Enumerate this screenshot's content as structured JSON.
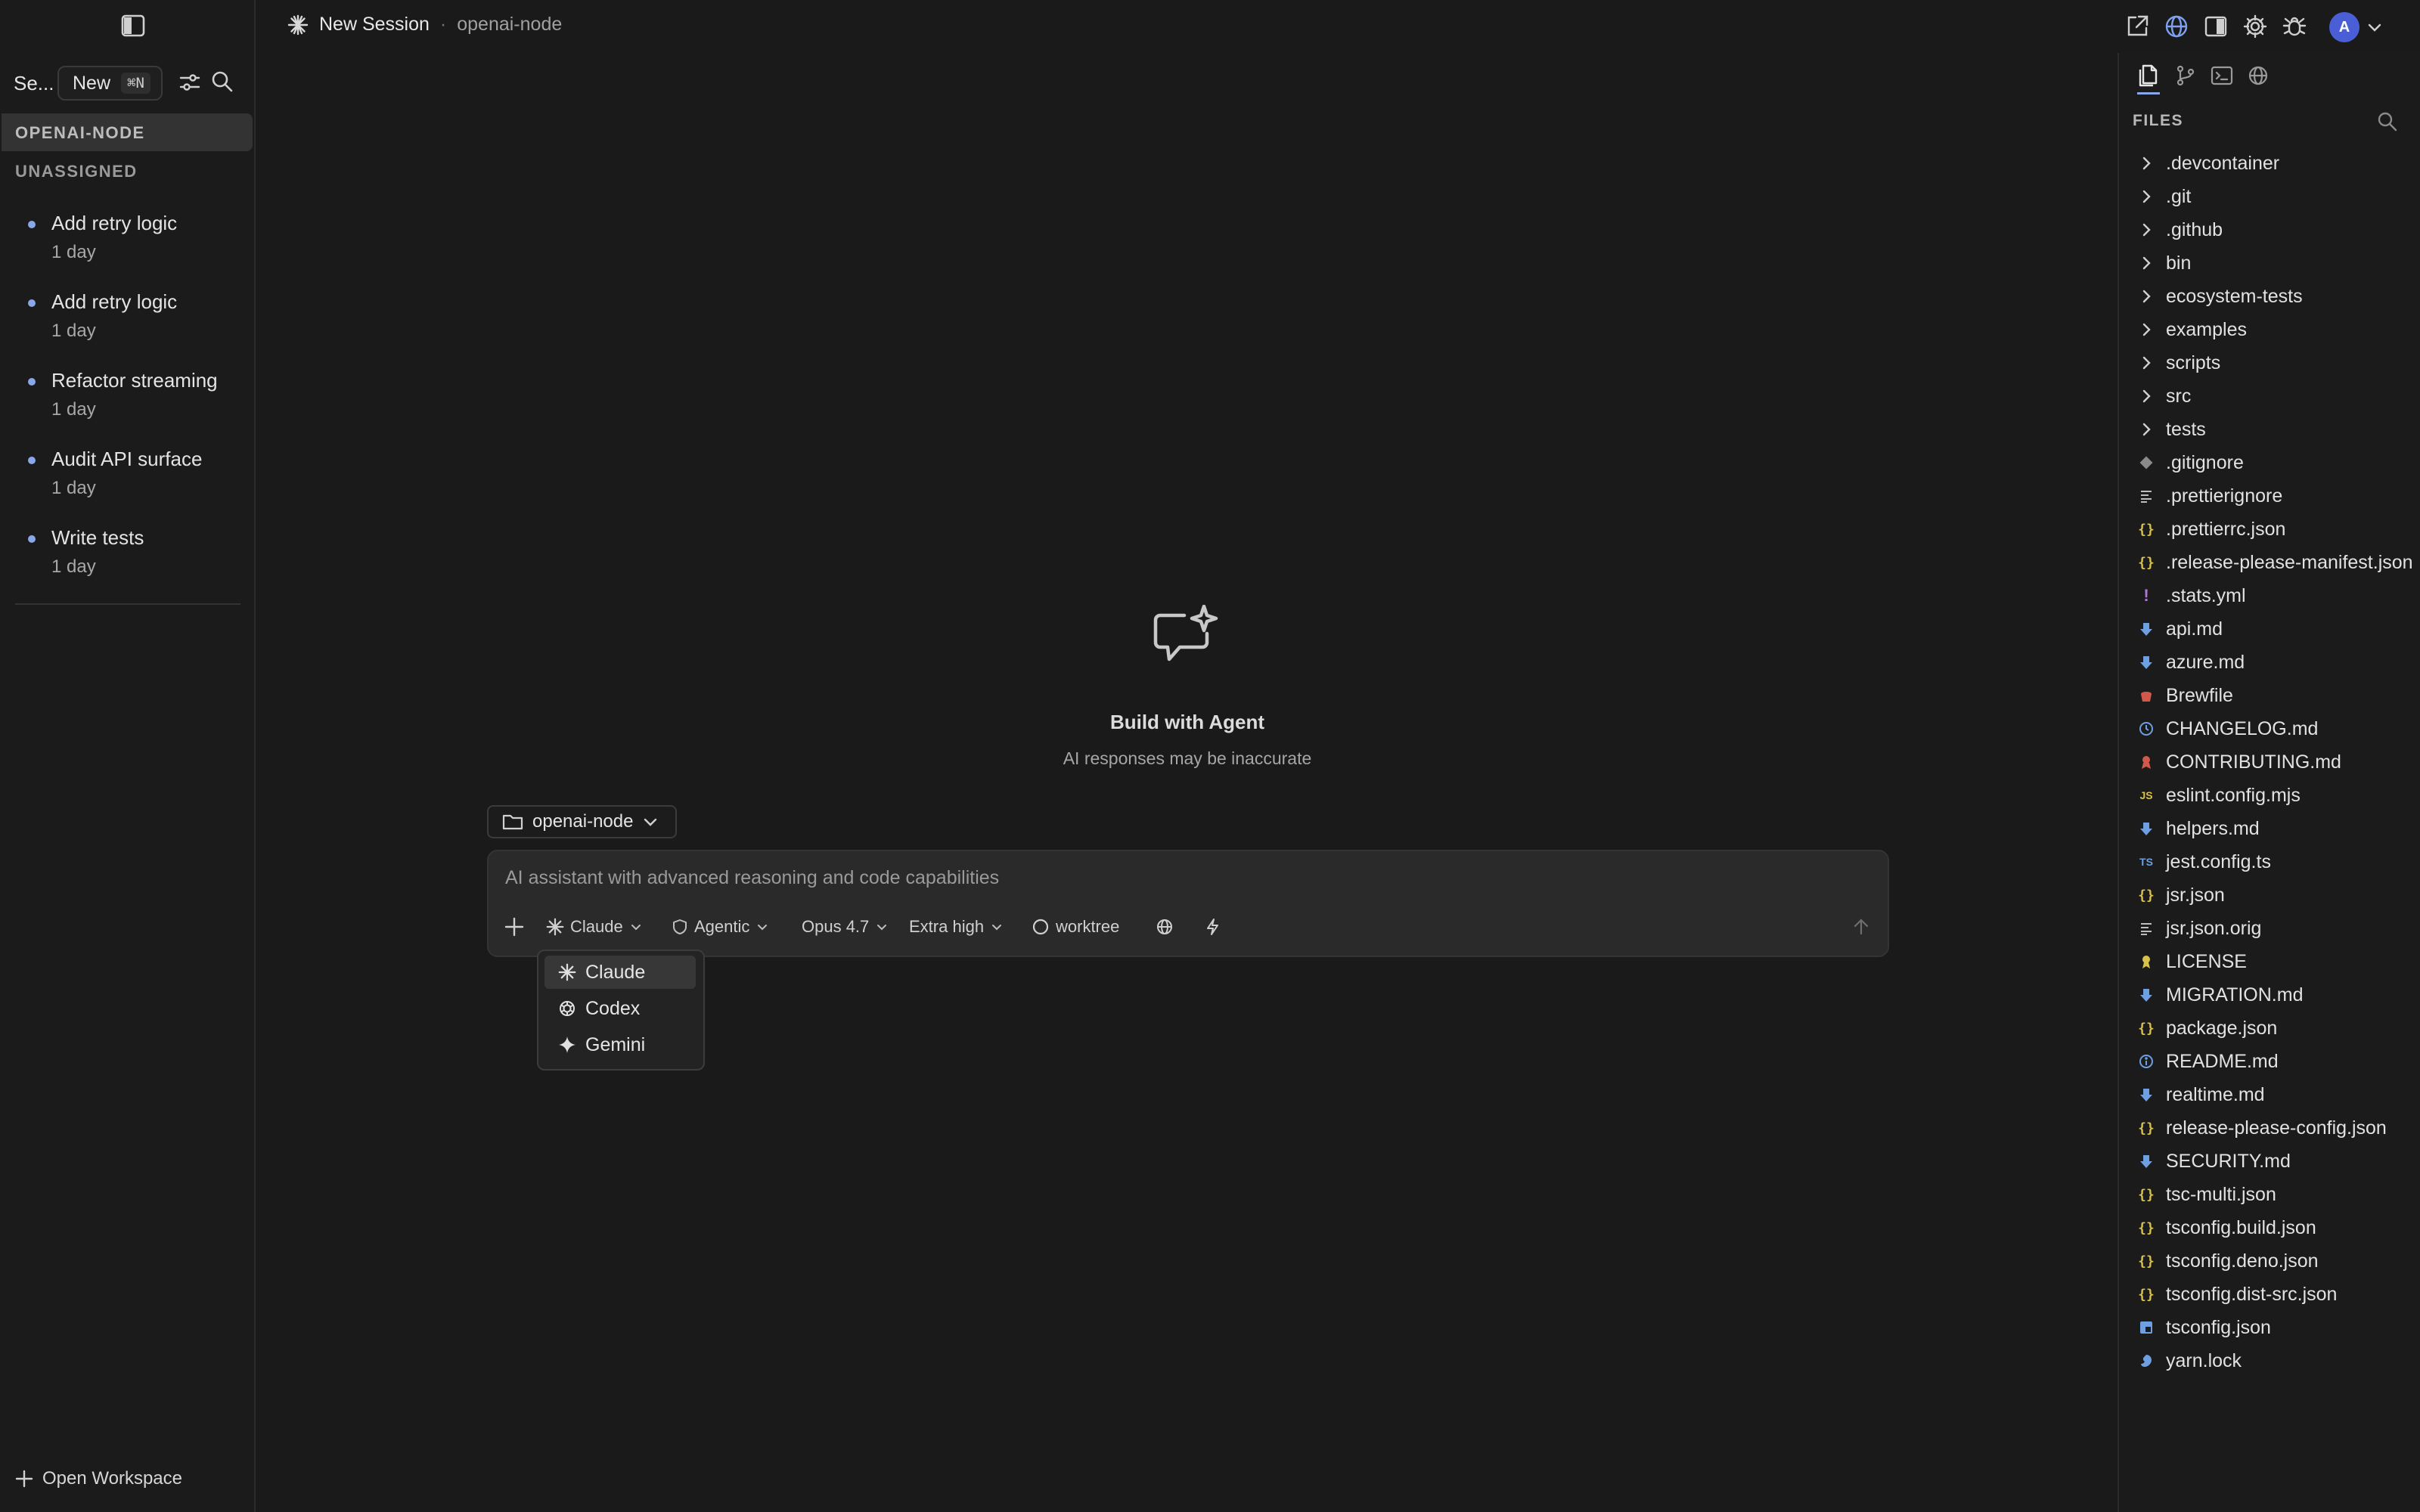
{
  "sidebar": {
    "title": "Se...",
    "new_label": "New",
    "new_shortcut": "⌘N",
    "group_repo": "OPENAI-NODE",
    "group_unassigned": "UNASSIGNED",
    "sessions": [
      {
        "name": "Add retry logic",
        "age": "1 day"
      },
      {
        "name": "Add retry logic",
        "age": "1 day"
      },
      {
        "name": "Refactor streaming",
        "age": "1 day"
      },
      {
        "name": "Audit API surface",
        "age": "1 day"
      },
      {
        "name": "Write tests",
        "age": "1 day"
      }
    ],
    "open_workspace": "Open Workspace"
  },
  "header": {
    "title": "New Session",
    "separator": "·",
    "repo": "openai-node"
  },
  "main": {
    "heading": "Build with Agent",
    "subheading": "AI responses may be inaccurate",
    "repo_picker": "openai-node",
    "prompt_placeholder": "AI assistant with advanced reasoning and code capabilities",
    "controls": {
      "agent": "Claude",
      "mode": "Agentic",
      "model": "Opus 4.7",
      "effort": "Extra high",
      "worktree": "worktree"
    },
    "agent_menu": [
      "Claude",
      "Codex",
      "Gemini"
    ],
    "selected_agent": "Claude"
  },
  "files": {
    "label": "FILES",
    "folders": [
      ".devcontainer",
      ".git",
      ".github",
      "bin",
      "ecosystem-tests",
      "examples",
      "scripts",
      "src",
      "tests"
    ],
    "entries": [
      {
        "name": ".gitignore",
        "icon": "git-diamond-icon",
        "color": "#8a8a8a"
      },
      {
        "name": ".prettierignore",
        "icon": "lines-icon",
        "color": "#bdbdbd"
      },
      {
        "name": ".prettierrc.json",
        "icon": "braces-icon",
        "color": "#d8c24a"
      },
      {
        "name": ".release-please-manifest.json",
        "icon": "braces-icon",
        "color": "#d8c24a"
      },
      {
        "name": ".stats.yml",
        "icon": "exclamation-icon",
        "color": "#b07ad8"
      },
      {
        "name": "api.md",
        "icon": "markdown-arrow-icon",
        "color": "#6e9fe0"
      },
      {
        "name": "azure.md",
        "icon": "markdown-arrow-icon",
        "color": "#6e9fe0"
      },
      {
        "name": "Brewfile",
        "icon": "brew-icon",
        "color": "#d2584c"
      },
      {
        "name": "CHANGELOG.md",
        "icon": "clock-icon",
        "color": "#6e9fe0"
      },
      {
        "name": "CONTRIBUTING.md",
        "icon": "ribbon-icon",
        "color": "#d2584c"
      },
      {
        "name": "eslint.config.mjs",
        "icon": "js-icon",
        "color": "#d8c24a"
      },
      {
        "name": "helpers.md",
        "icon": "markdown-arrow-icon",
        "color": "#6e9fe0"
      },
      {
        "name": "jest.config.ts",
        "icon": "ts-icon",
        "color": "#6e9fe0"
      },
      {
        "name": "jsr.json",
        "icon": "braces-icon",
        "color": "#d8c24a"
      },
      {
        "name": "jsr.json.orig",
        "icon": "lines-icon",
        "color": "#bdbdbd"
      },
      {
        "name": "LICENSE",
        "icon": "license-icon",
        "color": "#d8c24a"
      },
      {
        "name": "MIGRATION.md",
        "icon": "markdown-arrow-icon",
        "color": "#6e9fe0"
      },
      {
        "name": "package.json",
        "icon": "braces-icon",
        "color": "#d8c24a"
      },
      {
        "name": "README.md",
        "icon": "info-icon",
        "color": "#6e9fe0"
      },
      {
        "name": "realtime.md",
        "icon": "markdown-arrow-icon",
        "color": "#6e9fe0"
      },
      {
        "name": "release-please-config.json",
        "icon": "braces-icon",
        "color": "#d8c24a"
      },
      {
        "name": "SECURITY.md",
        "icon": "markdown-arrow-icon",
        "color": "#6e9fe0"
      },
      {
        "name": "tsc-multi.json",
        "icon": "braces-icon",
        "color": "#d8c24a"
      },
      {
        "name": "tsconfig.build.json",
        "icon": "braces-icon",
        "color": "#d8c24a"
      },
      {
        "name": "tsconfig.deno.json",
        "icon": "braces-icon",
        "color": "#d8c24a"
      },
      {
        "name": "tsconfig.dist-src.json",
        "icon": "braces-icon",
        "color": "#d8c24a"
      },
      {
        "name": "tsconfig.json",
        "icon": "tsconfig-icon",
        "color": "#6e9fe0"
      },
      {
        "name": "yarn.lock",
        "icon": "yarn-icon",
        "color": "#6e9fe0"
      }
    ]
  },
  "colors": {
    "background": "#1a1a1a",
    "panel": "#1b1b1b",
    "composer": "#2a2a2a",
    "accent": "#4a5fd6",
    "session_dot": "#8aa7e8"
  }
}
